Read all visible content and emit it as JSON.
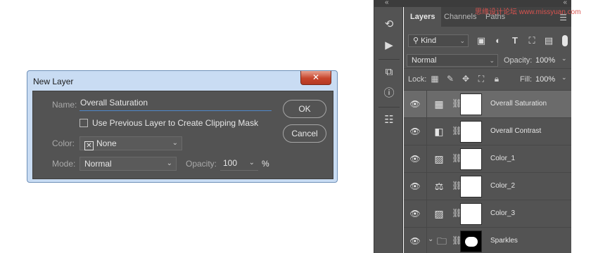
{
  "dialog": {
    "title": "New Layer",
    "close_glyph": "✕",
    "name_label": "Name:",
    "name_value": "Overall Saturation",
    "clip_label": "Use Previous Layer to Create Clipping Mask",
    "color_label": "Color:",
    "color_value": "None",
    "mode_label": "Mode:",
    "mode_value": "Normal",
    "opacity_label": "Opacity:",
    "opacity_value": "100",
    "opacity_unit": "%",
    "ok_label": "OK",
    "cancel_label": "Cancel"
  },
  "watermark": "思缘设计论坛 www.missyuan.com",
  "panel": {
    "collapse_glyph": "«",
    "tabs": [
      "Layers",
      "Channels",
      "Paths"
    ],
    "filter_label": "Kind",
    "blend_mode": "Normal",
    "opacity_label": "Opacity:",
    "opacity_value": "100%",
    "lock_label": "Lock:",
    "fill_label": "Fill:",
    "fill_value": "100%",
    "layers": [
      {
        "name": "Overall Saturation",
        "icon": "curves-icon",
        "selected": true
      },
      {
        "name": "Overall Contrast",
        "icon": "gradient-map-icon",
        "selected": false
      },
      {
        "name": "Color_1",
        "icon": "selective-color-icon",
        "selected": false
      },
      {
        "name": "Color_2",
        "icon": "color-balance-icon",
        "selected": false
      },
      {
        "name": "Color_3",
        "icon": "selective-color-icon",
        "selected": false
      },
      {
        "name": "Sparkles",
        "icon": "folder-icon",
        "selected": false
      }
    ]
  }
}
